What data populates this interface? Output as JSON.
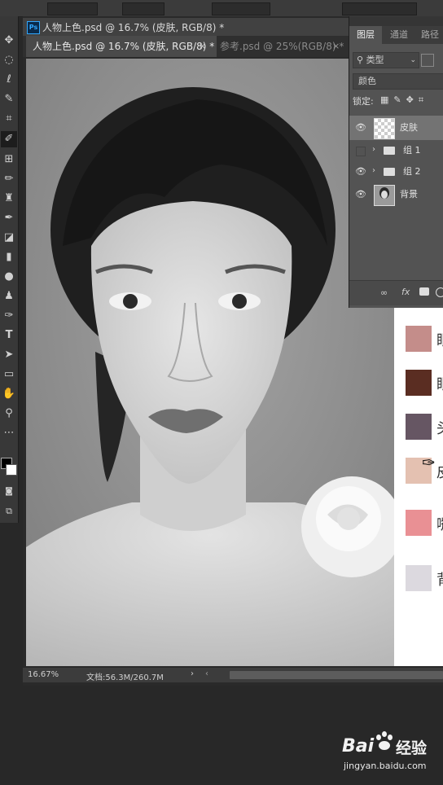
{
  "document_tabs": [
    {
      "label": "人物上色.psd @ 16.7% (皮肤, RGB/8) *",
      "active": true
    },
    {
      "label": "参考.psd @ 25%(RGB/8) *",
      "active": false
    }
  ],
  "window_title": "人物上色.psd @ 16.7% (皮肤, RGB/8) *",
  "close_glyph": "×",
  "tools": [
    "move-icon",
    "marquee-icon",
    "lasso-icon",
    "quick-select-icon",
    "crop-icon",
    "eyedropper-icon",
    "healing-icon",
    "brush-icon",
    "stamp-icon",
    "history-brush-icon",
    "eraser-icon",
    "gradient-icon",
    "blur-icon",
    "dodge-icon",
    "pen-icon",
    "type-icon",
    "path-select-icon",
    "rectangle-icon",
    "hand-icon",
    "zoom-icon",
    "more-tools-icon"
  ],
  "layers_panel": {
    "tabs": [
      "图层",
      "通道",
      "路径"
    ],
    "filter_label": "类型",
    "blend_mode": "颜色",
    "lock_label": "锁定:",
    "layers": [
      {
        "name": "皮肤",
        "visible": true,
        "selected": true,
        "kind": "transparent"
      },
      {
        "name": "组 1",
        "visible": false,
        "selected": false,
        "kind": "group"
      },
      {
        "name": "组 2",
        "visible": true,
        "selected": false,
        "kind": "group"
      },
      {
        "name": "背景",
        "visible": true,
        "selected": false,
        "kind": "photo"
      }
    ],
    "footer_icons": [
      "link-icon",
      "fx-icon",
      "mask-icon",
      "adjustment-icon"
    ],
    "fx_text": "fx"
  },
  "swatches": [
    {
      "color": "#c48d8a",
      "label": "眼"
    },
    {
      "color": "#5a2d22",
      "label": "眼"
    },
    {
      "color": "#665663",
      "label": "头"
    },
    {
      "color": "#e4c1b1",
      "label": "皮"
    },
    {
      "color": "#e99094",
      "label": "嘴"
    },
    {
      "color": "#dcd9df",
      "label": "背"
    }
  ],
  "status": {
    "zoom": "16.67%",
    "doc_info": "文档:56.3M/260.7M"
  },
  "watermark": {
    "brand": "Bai",
    "brand_cn": "经验",
    "url": "jingyan.baidu.com"
  }
}
